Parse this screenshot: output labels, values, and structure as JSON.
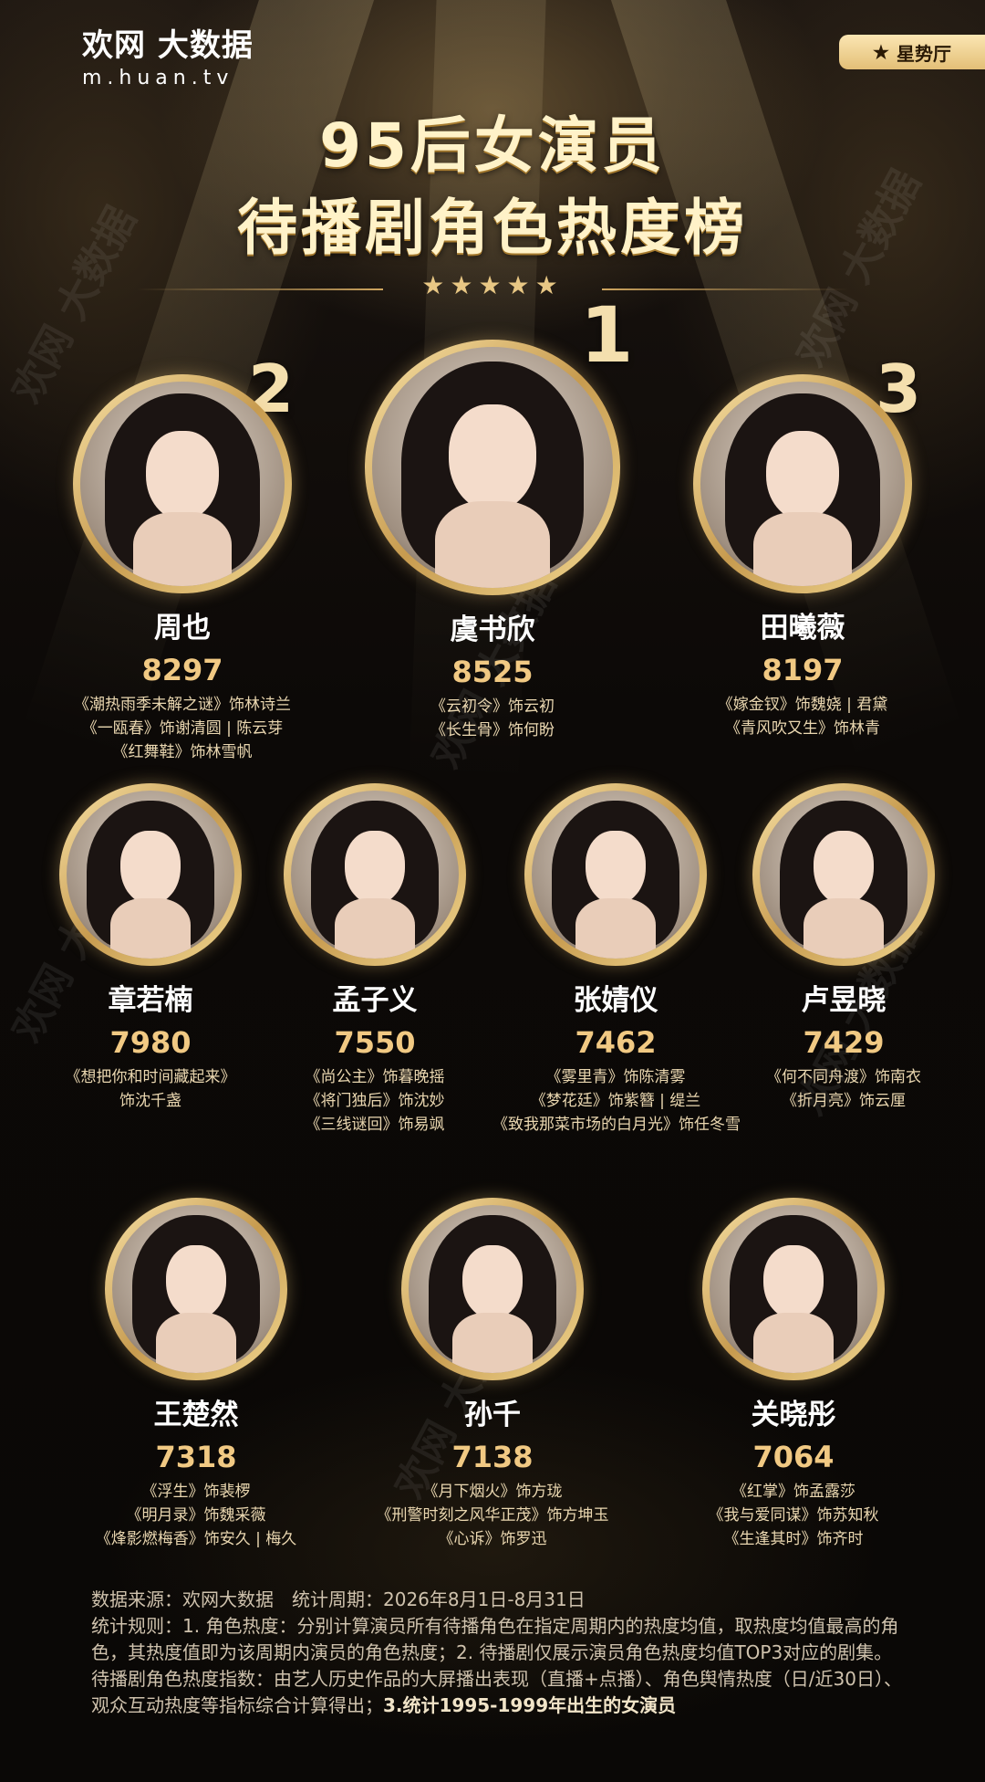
{
  "brand": {
    "name": "欢网 大数据",
    "url": "m.huan.tv"
  },
  "badge": {
    "icon": "star-icon",
    "label": "星势厅"
  },
  "title": {
    "line1": "95后女演员",
    "line2": "待播剧角色热度榜"
  },
  "stars": "★★★★★",
  "ranks": {
    "first": "1",
    "second": "2",
    "third": "3"
  },
  "actresses": [
    {
      "name": "周也",
      "score": "8297",
      "roles": [
        "《潮热雨季未解之谜》饰林诗兰",
        "《一瓯春》饰谢清圆 | 陈云芽",
        "《红舞鞋》饰林雪帆"
      ]
    },
    {
      "name": "虞书欣",
      "score": "8525",
      "roles": [
        "《云初令》饰云初",
        "《长生骨》饰何盼"
      ]
    },
    {
      "name": "田曦薇",
      "score": "8197",
      "roles": [
        "《嫁金钗》饰魏娆 | 君黛",
        "《青风吹又生》饰林青"
      ]
    },
    {
      "name": "章若楠",
      "score": "7980",
      "roles": [
        "《想把你和时间藏起来》",
        "饰沈千盏"
      ]
    },
    {
      "name": "孟子义",
      "score": "7550",
      "roles": [
        "《尚公主》饰暮晚摇",
        "《将门独后》饰沈妙",
        "《三线谜回》饰易飒"
      ]
    },
    {
      "name": "张婧仪",
      "score": "7462",
      "roles": [
        "《雾里青》饰陈清雾",
        "《梦花廷》饰紫簪 | 缇兰",
        "《致我那菜市场的白月光》饰任冬雪"
      ]
    },
    {
      "name": "卢昱晓",
      "score": "7429",
      "roles": [
        "《何不同舟渡》饰南衣",
        "《折月亮》饰云厘"
      ]
    },
    {
      "name": "王楚然",
      "score": "7318",
      "roles": [
        "《浮生》饰裴椤",
        "《明月录》饰魏采薇",
        "《烽影燃梅香》饰安久 | 梅久"
      ]
    },
    {
      "name": "孙千",
      "score": "7138",
      "roles": [
        "《月下烟火》饰方珑",
        "《刑警时刻之风华正茂》饰方坤玉",
        "《心诉》饰罗迅"
      ]
    },
    {
      "name": "关晓彤",
      "score": "7064",
      "roles": [
        "《红掌》饰孟露莎",
        "《我与爱同谋》饰苏知秋",
        "《生逢其时》饰齐时"
      ]
    }
  ],
  "footer": {
    "line1": "数据来源：欢网大数据　统计周期：2026年8月1日-8月31日",
    "line2": "统计规则：1. 角色热度：分别计算演员所有待播角色在指定周期内的热度均值，取热度均值最高的角色，其热度值即为该周期内演员的角色热度；2. 待播剧仅展示演员角色热度均值TOP3对应的剧集。",
    "line3": "待播剧角色热度指数：由艺人历史作品的大屏播出表现（直播+点播）、角色舆情热度（日/近30日）、观众互动热度等指标综合计算得出；",
    "line3_bold": "3.统计1995-1999年出生的女演员"
  },
  "watermark": "欢网 大数据"
}
